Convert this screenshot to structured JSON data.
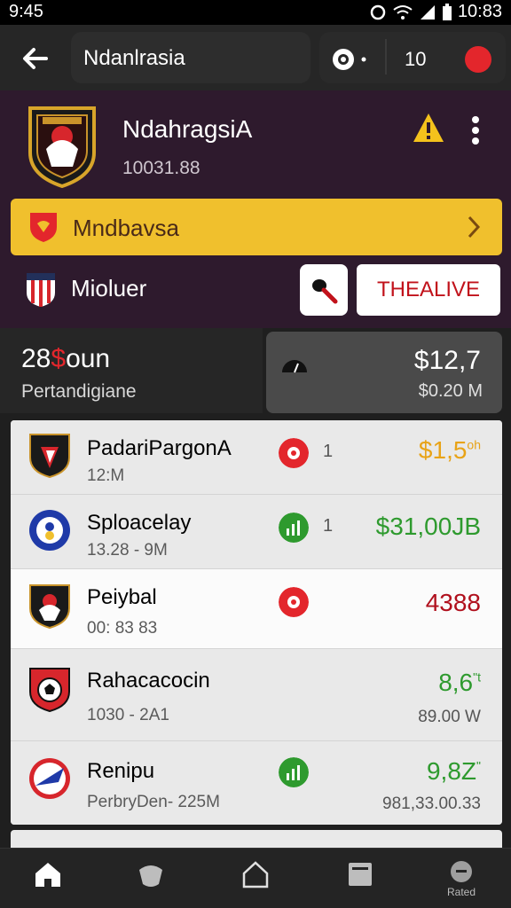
{
  "status_bar": {
    "time": "9:45",
    "right_time": "10:83"
  },
  "app_bar": {
    "title": "Ndanlrasia",
    "count": "10"
  },
  "club": {
    "name": "NdahragsiA",
    "subtitle": "10031.88",
    "highlight_label": "Mndbavsa",
    "secondary_name": "Mioluer",
    "live_button": "THEALIVE"
  },
  "stats": {
    "left_value_num": "28",
    "left_value_symbol": "$",
    "left_value_unit": "oun",
    "left_label": "Pertandigiane",
    "right_value": "$12,7",
    "right_sub": "$0.20 M"
  },
  "rows": [
    {
      "name": "PadariPargonA",
      "sub": "12:M",
      "badge_num": "1",
      "value": "$1,5",
      "value_sup": "oh",
      "value2": "",
      "badge": "red",
      "value_color": "#e8a317",
      "name_color": "#6b1530"
    },
    {
      "name": "Sploacelay",
      "sub": "13.28 - 9M",
      "badge_num": "1",
      "value": "$31,00JB",
      "value_sup": "",
      "value2": "",
      "badge": "green",
      "value_color": "#2e9a2e",
      "name_color": "#1a1a1a"
    },
    {
      "name": "Peiybal",
      "sub": "00: 83 83",
      "badge_num": "",
      "value": "4388",
      "value_sup": "",
      "value2": "",
      "badge": "red",
      "value_color": "#b0101d",
      "name_color": "#6b1530"
    },
    {
      "name": "Rahacacocin",
      "sub": "1030 - 2A1",
      "badge_num": "",
      "value": "8,6",
      "value_sup": "\"t",
      "value2": "89.00 W",
      "badge": "",
      "value_color": "#2e9a2e",
      "name_color": "#1a1a1a"
    },
    {
      "name": "Renipu",
      "sub": "PerbryDen- 225M",
      "badge_num": "",
      "value": "9,8Z",
      "value_sup": "\"",
      "value2": "981,33.00.33",
      "badge": "green",
      "value_color": "#2e9a2e",
      "name_color": "#1a1a1a"
    }
  ],
  "nav": {
    "last_label": "Rated"
  },
  "colors": {
    "accent_red": "#e3262c",
    "accent_yellow": "#f0c02d",
    "header_bg": "#2e1a2d",
    "green": "#2e9a2e"
  }
}
